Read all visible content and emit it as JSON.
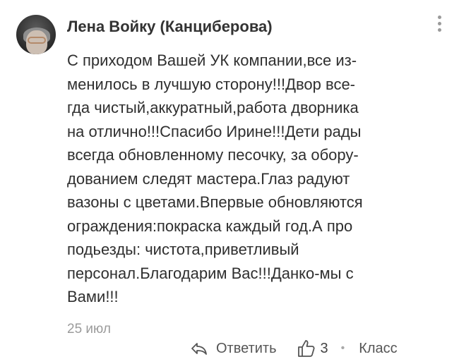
{
  "comment": {
    "author": "Лена Войку (Канциберова)",
    "text_lines": [
      "С приходом Вашей УК компании,все из-",
      "менилось в лучшую сторону!!!Двор все-",
      "гда чистый,аккуратный,работа дворника",
      "на отлично!!!Спасибо Ирине!!!Дети рады",
      "всегда обновленному песочку, за обору-",
      "дованием следят мастера.Глаз радуют",
      "вазоны с цветами.Впервые обновляются",
      "ограждения:покраска каждый год.А про",
      "подьезды: чистота,приветливый",
      "персонал.Благодарим Вас!!!Данко-мы с",
      "Вами!!!"
    ],
    "date": "25 июл"
  },
  "actions": {
    "reply_label": "Ответить",
    "like_count": "3",
    "klass_label": "Класс"
  },
  "icons": {
    "menu": "more-vertical-icon",
    "reply": "reply-arrow-icon",
    "like": "thumbs-up-icon"
  },
  "colors": {
    "text": "#2f2f2f",
    "muted": "#9b9b9b",
    "icon": "#555555"
  }
}
